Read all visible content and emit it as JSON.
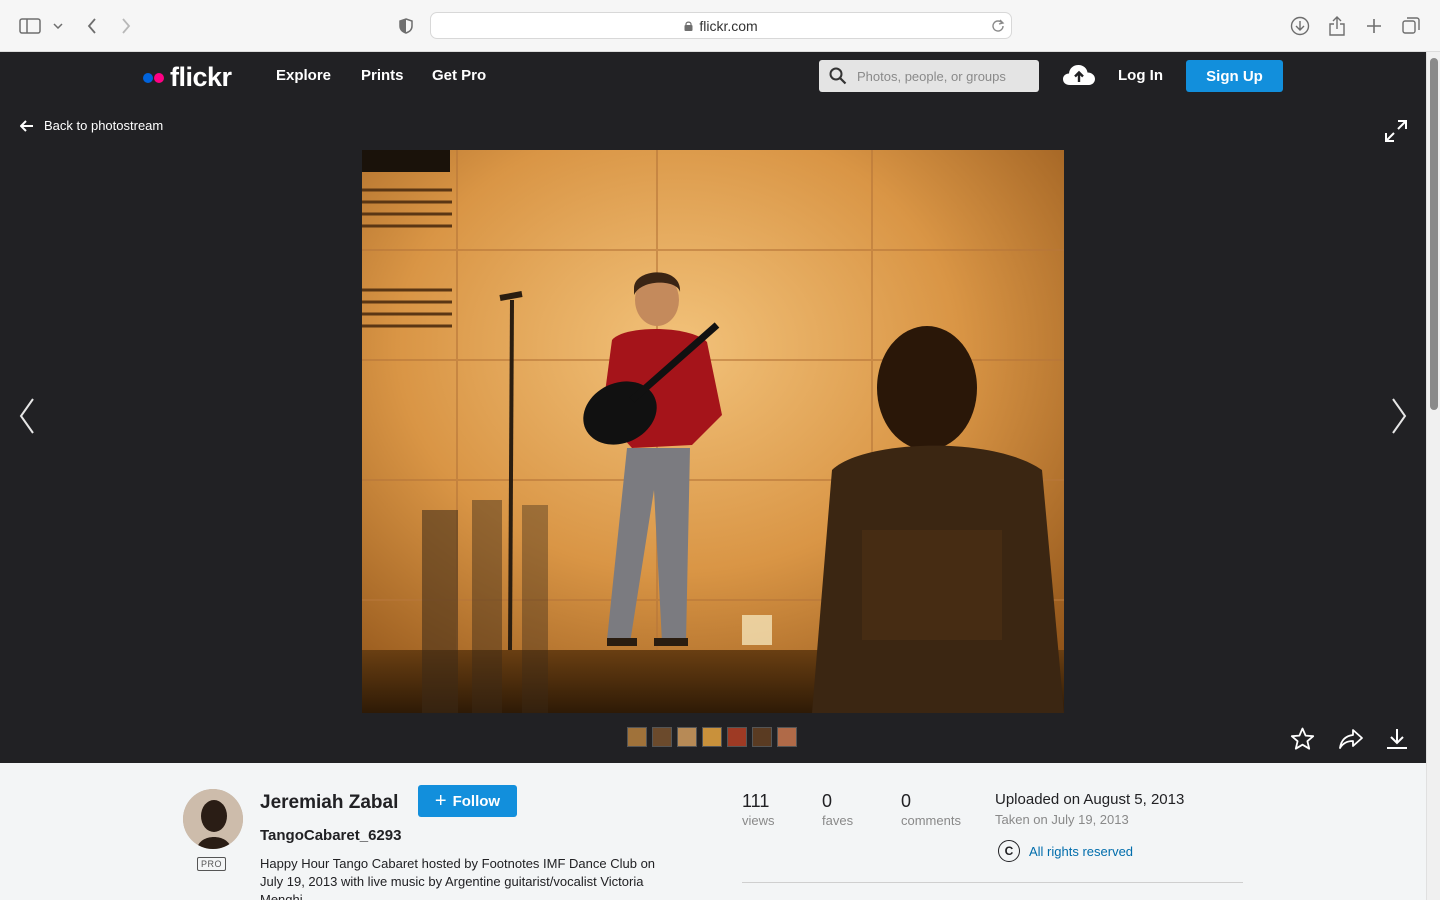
{
  "browser": {
    "url": "flickr.com"
  },
  "nav": {
    "logo_text": "flickr",
    "logo_colors": {
      "blue": "#0063dc",
      "pink": "#ff0084"
    },
    "links": [
      "Explore",
      "Prints",
      "Get Pro"
    ],
    "search_placeholder": "Photos, people, or groups",
    "login_label": "Log In",
    "signup_label": "Sign Up"
  },
  "viewer": {
    "back_label": "Back to photostream",
    "thumbnails": [
      {
        "color": "#a0723a"
      },
      {
        "color": "#6b4a2c"
      },
      {
        "color": "#b78a56"
      },
      {
        "color": "#c9913b"
      },
      {
        "color": "#9e3a24"
      },
      {
        "color": "#5a3b22"
      },
      {
        "color": "#b06a48"
      }
    ]
  },
  "info": {
    "author": "Jeremiah Zabal",
    "pro_badge": "PRO",
    "follow_label": "Follow",
    "photo_title": "TangoCabaret_6293",
    "description": "Happy Hour Tango Cabaret hosted by Footnotes IMF Dance Club on July 19, 2013 with live music by Argentine guitarist/vocalist Victoria Menghi",
    "stats": [
      {
        "value": "111",
        "label": "views"
      },
      {
        "value": "0",
        "label": "faves"
      },
      {
        "value": "0",
        "label": "comments"
      }
    ],
    "uploaded": "Uploaded on August 5, 2013",
    "taken": "Taken on July 19, 2013",
    "license_icon": "C",
    "license": "All rights reserved"
  },
  "colors": {
    "accent": "#128fdc",
    "dark_bg": "#212124",
    "link": "#006dac"
  }
}
